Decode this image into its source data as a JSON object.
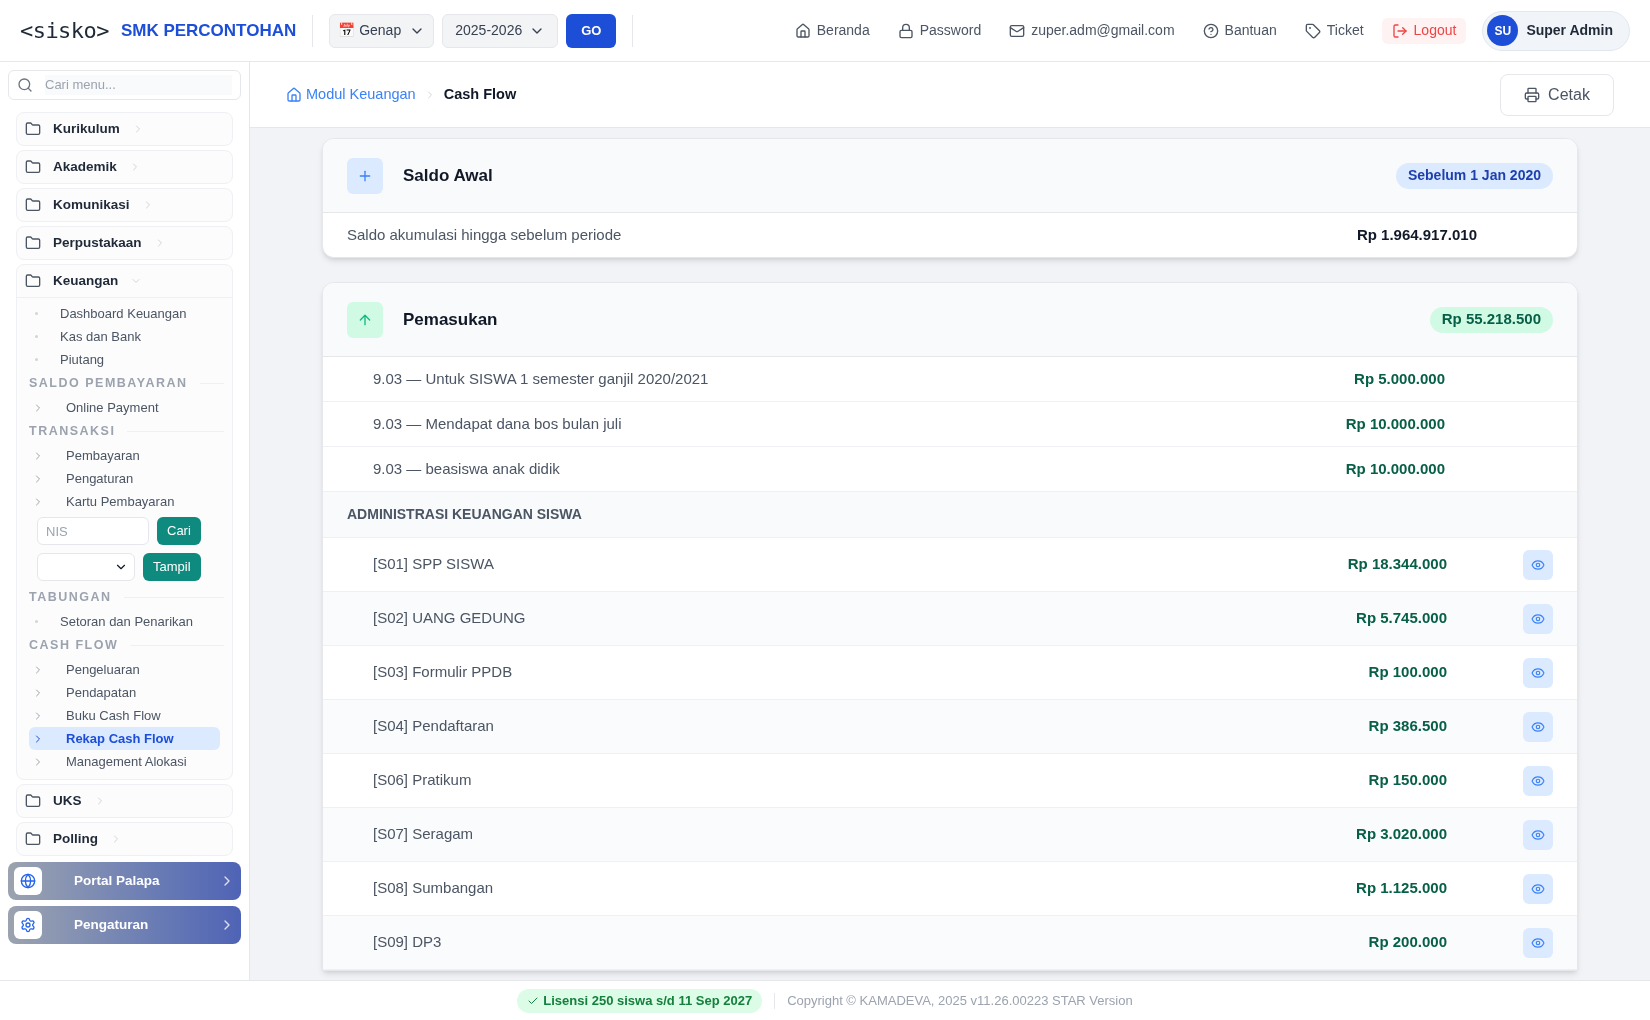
{
  "header": {
    "logo": "<sisko>",
    "school": "SMK PERCONTOHAN",
    "semester": {
      "emoji": "📅",
      "value": "Genap"
    },
    "year": {
      "value": "2025-2026"
    },
    "go": "GO",
    "nav": [
      {
        "kind": "home",
        "label": "Beranda"
      },
      {
        "kind": "lock",
        "label": "Password"
      },
      {
        "kind": "mail",
        "label": "zuper.adm@gmail.com"
      },
      {
        "kind": "help",
        "label": "Bantuan"
      },
      {
        "kind": "tag",
        "label": "Ticket"
      },
      {
        "kind": "logout",
        "label": "Logout"
      }
    ],
    "user": {
      "initials": "SU",
      "name": "Super Admin"
    }
  },
  "sidebar": {
    "search": {
      "placeholder": "Cari menu..."
    },
    "menus": [
      {
        "label": "Kurikulum",
        "expanded": false
      },
      {
        "label": "Akademik",
        "expanded": false
      },
      {
        "label": "Komunikasi",
        "expanded": false
      },
      {
        "label": "Perpustakaan",
        "expanded": false
      },
      {
        "label": "Keuangan",
        "expanded": true,
        "children": [
          {
            "kind": "dot",
            "label": "Dashboard Keuangan",
            "selected": false
          },
          {
            "kind": "dot",
            "label": "Kas dan Bank",
            "selected": false
          },
          {
            "kind": "dot",
            "label": "Piutang",
            "selected": false
          },
          {
            "kind": "heading",
            "label": "SALDO PEMBAYARAN"
          },
          {
            "kind": "chevron",
            "label": "Online Payment",
            "selected": false
          },
          {
            "kind": "heading",
            "label": "TRANSAKSI"
          },
          {
            "kind": "chevron",
            "label": "Pembayaran",
            "selected": false
          },
          {
            "kind": "chevron",
            "label": "Pengaturan",
            "selected": false
          },
          {
            "kind": "chevron",
            "label": "Kartu Pembayaran",
            "selected": false
          },
          {
            "kind": "input",
            "placeholder": "NIS",
            "button": "Cari"
          },
          {
            "kind": "select",
            "button": "Tampil"
          },
          {
            "kind": "heading",
            "label": "TABUNGAN"
          },
          {
            "kind": "dot",
            "label": "Setoran dan Penarikan",
            "selected": false
          },
          {
            "kind": "heading",
            "label": "CASH FLOW"
          },
          {
            "kind": "chevron",
            "label": "Pengeluaran",
            "selected": false
          },
          {
            "kind": "chevron",
            "label": "Pendapatan",
            "selected": false
          },
          {
            "kind": "chevron",
            "label": "Buku Cash Flow",
            "selected": false
          },
          {
            "kind": "chevron",
            "label": "Rekap Cash Flow",
            "selected": true
          },
          {
            "kind": "chevron",
            "label": "Management Alokasi",
            "selected": false
          }
        ]
      },
      {
        "label": "UKS",
        "expanded": false
      },
      {
        "label": "Polling",
        "expanded": false
      }
    ],
    "portals": [
      {
        "kind": "globe",
        "label": "Portal Palapa"
      },
      {
        "kind": "gear",
        "label": "Pengaturan"
      }
    ]
  },
  "breadcrumb": {
    "parent": "Modul Keuangan",
    "current": "Cash Flow",
    "print": "Cetak"
  },
  "saldo_awal": {
    "title": "Saldo Awal",
    "badge": "Sebelum 1 Jan 2020",
    "description": "Saldo akumulasi hingga sebelum periode",
    "amount": "Rp 1.964.917.010"
  },
  "pemasukan": {
    "title": "Pemasukan",
    "total": "Rp 55.218.500",
    "items": [
      {
        "label": "9.03 — Untuk SISWA 1 semester ganjil 2020/2021",
        "amount": "Rp 5.000.000"
      },
      {
        "label": "9.03 — Mendapat dana bos bulan juli",
        "amount": "Rp 10.000.000"
      },
      {
        "label": "9.03 — beasiswa anak didik",
        "amount": "Rp 10.000.000"
      }
    ],
    "section": "ADMINISTRASI KEUANGAN SISWA",
    "rows": [
      {
        "label": "[S01] SPP SISWA",
        "amount": "Rp 18.344.000"
      },
      {
        "label": "[S02] UANG GEDUNG",
        "amount": "Rp 5.745.000"
      },
      {
        "label": "[S03] Formulir PPDB",
        "amount": "Rp 100.000"
      },
      {
        "label": "[S04] Pendaftaran",
        "amount": "Rp 386.500"
      },
      {
        "label": "[S06] Pratikum",
        "amount": "Rp 150.000"
      },
      {
        "label": "[S07] Seragam",
        "amount": "Rp 3.020.000"
      },
      {
        "label": "[S08] Sumbangan",
        "amount": "Rp 1.125.000"
      },
      {
        "label": "[S09] DP3",
        "amount": "Rp 200.000"
      }
    ]
  },
  "footer": {
    "license": "Lisensi 250 siswa s/d 11 Sep 2027",
    "copyright": "Copyright © KAMADEVA, 2025 v11.26.00223 STAR Version"
  }
}
